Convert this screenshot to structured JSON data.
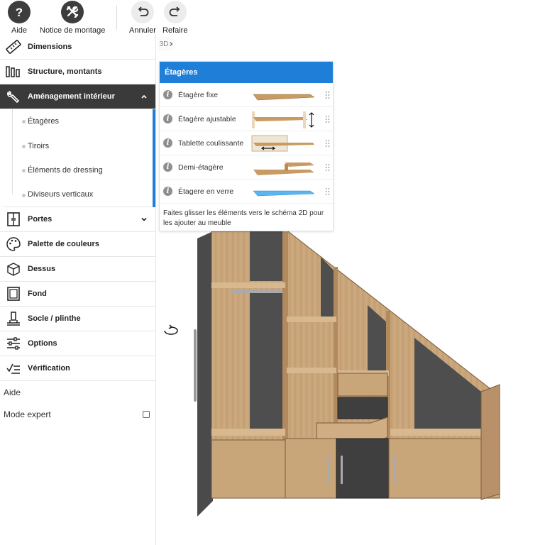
{
  "toolbar": {
    "help": {
      "label": "Aide",
      "icon": "help-icon"
    },
    "manual": {
      "label": "Notice de montage",
      "icon": "tools-icon"
    },
    "undo": {
      "label": "Annuler",
      "icon": "undo-icon"
    },
    "redo": {
      "label": "Refaire",
      "icon": "redo-icon"
    }
  },
  "sidebar": {
    "items": [
      {
        "label": "Dimensions",
        "icon": "ruler-icon"
      },
      {
        "label": "Structure, montants",
        "icon": "uprights-icon"
      },
      {
        "label": "Aménagement intérieur",
        "icon": "wrench-icon"
      },
      {
        "label": "Portes",
        "icon": "door-icon"
      },
      {
        "label": "Palette de couleurs",
        "icon": "palette-icon"
      },
      {
        "label": "Dessus",
        "icon": "top-box-icon"
      },
      {
        "label": "Fond",
        "icon": "back-panel-icon"
      },
      {
        "label": "Socle / plinthe",
        "icon": "plinth-icon"
      },
      {
        "label": "Options",
        "icon": "sliders-icon"
      },
      {
        "label": "Vérification",
        "icon": "checklist-icon"
      }
    ],
    "subitems": [
      "Étagères",
      "Tiroirs",
      "Éléments de dressing",
      "Diviseurs verticaux"
    ],
    "help_label": "Aide",
    "expert_label": "Mode expert"
  },
  "breadcrumb": "3D",
  "panel": {
    "title": "Étagères",
    "rows": [
      {
        "label": "Étagère fixe"
      },
      {
        "label": "Étagère ajustable"
      },
      {
        "label": "Tablette coulissante"
      },
      {
        "label": "Demi-étagère"
      },
      {
        "label": "Étagere en verre"
      }
    ],
    "footer": "Faites glisser les éléments vers le schéma 2D pour les ajouter au meuble"
  },
  "colors": {
    "accent": "#1f7fd8",
    "dark": "#3a3a3a",
    "wood": "#c9a57a",
    "anthracite": "#4a4a4a"
  }
}
